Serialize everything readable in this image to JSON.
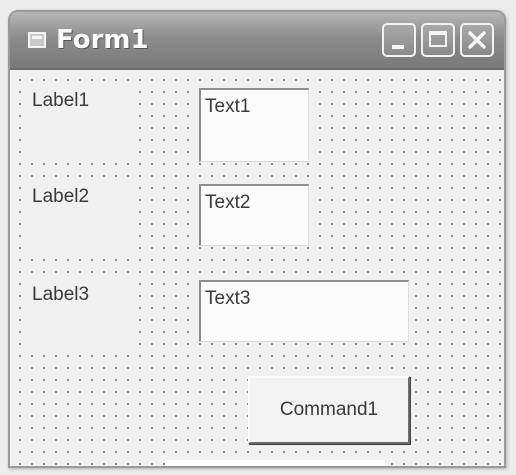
{
  "window": {
    "title": "Form1",
    "controls": [
      "minimize-icon",
      "maximize-icon",
      "close-icon"
    ]
  },
  "form": {
    "labels": [
      "Label1",
      "Label2",
      "Label3"
    ],
    "textboxes": [
      "Text1",
      "Text2",
      "Text3"
    ],
    "command_button": "Command1"
  },
  "colors": {
    "titlebar": "#8c8c8c",
    "client": "#f1f1f1",
    "grid_dots": "#7a7a7a"
  }
}
